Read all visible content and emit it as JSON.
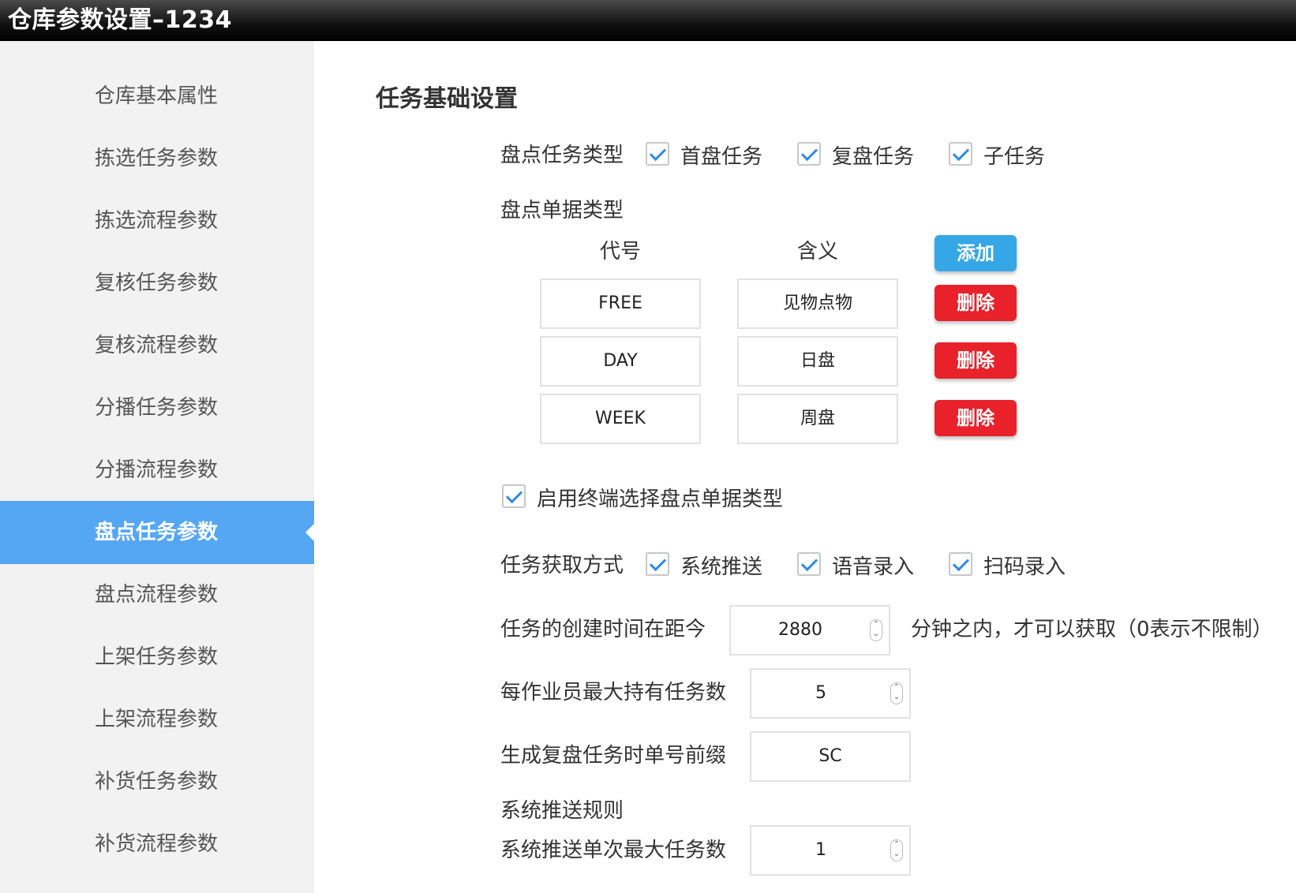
{
  "window": {
    "title": "仓库参数设置–1234"
  },
  "sidebar": {
    "items": [
      {
        "label": "仓库基本属性"
      },
      {
        "label": "拣选任务参数"
      },
      {
        "label": "拣选流程参数"
      },
      {
        "label": "复核任务参数"
      },
      {
        "label": "复核流程参数"
      },
      {
        "label": "分播任务参数"
      },
      {
        "label": "分播流程参数"
      },
      {
        "label": "盘点任务参数"
      },
      {
        "label": "盘点流程参数"
      },
      {
        "label": "上架任务参数"
      },
      {
        "label": "上架流程参数"
      },
      {
        "label": "补货任务参数"
      },
      {
        "label": "补货流程参数"
      }
    ],
    "active_index": 7
  },
  "main": {
    "section_title": "任务基础设置",
    "task_type": {
      "label": "盘点任务类型",
      "options": [
        {
          "label": "首盘任务",
          "checked": true
        },
        {
          "label": "复盘任务",
          "checked": true
        },
        {
          "label": "子任务",
          "checked": true
        }
      ]
    },
    "doc_type": {
      "label": "盘点单据类型",
      "col_code": "代号",
      "col_meaning": "含义",
      "add_label": "添加",
      "delete_label": "删除",
      "rows": [
        {
          "code": "FREE",
          "meaning": "见物点物"
        },
        {
          "code": "DAY",
          "meaning": "日盘"
        },
        {
          "code": "WEEK",
          "meaning": "周盘"
        }
      ]
    },
    "terminal_select": {
      "label": "启用终端选择盘点单据类型",
      "checked": true
    },
    "fetch_mode": {
      "label": "任务获取方式",
      "options": [
        {
          "label": "系统推送",
          "checked": true
        },
        {
          "label": "语音录入",
          "checked": true
        },
        {
          "label": "扫码录入",
          "checked": true
        }
      ]
    },
    "create_time": {
      "label": "任务的创建时间在距今",
      "value": "2880",
      "suffix": "分钟之内，才可以获取（0表示不限制）"
    },
    "max_tasks": {
      "label": "每作业员最大持有任务数",
      "value": "5"
    },
    "prefix": {
      "label": "生成复盘任务时单号前缀",
      "value": "SC"
    },
    "push_rules": {
      "label": "系统推送规则"
    },
    "push_max": {
      "label": "系统推送单次最大任务数",
      "value": "1"
    }
  },
  "colors": {
    "accent": "#55a7f4",
    "add": "#36a7e6",
    "delete": "#e9212a",
    "check": "#2e8ae6"
  }
}
